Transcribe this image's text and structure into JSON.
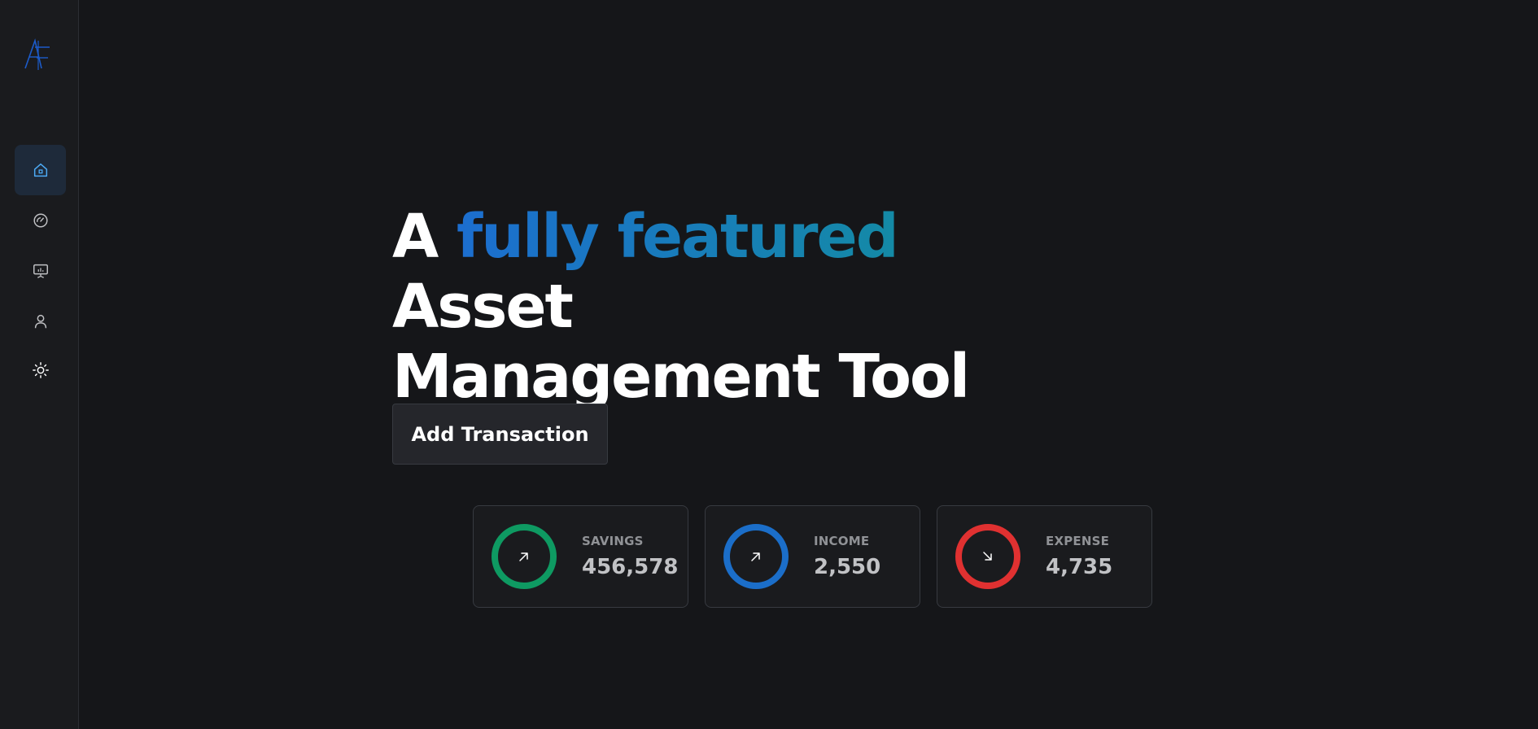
{
  "sidebar": {
    "logo": {
      "text": "AF",
      "color": "#1c5bc9"
    },
    "items": [
      {
        "icon": "home-icon",
        "active": true
      },
      {
        "icon": "gauge-icon",
        "active": false
      },
      {
        "icon": "presentation-chart-icon",
        "active": false
      },
      {
        "icon": "user-icon",
        "active": false
      },
      {
        "icon": "sun-icon",
        "active": false
      }
    ]
  },
  "hero": {
    "prefix": "A ",
    "highlight": "fully featured",
    "suffix_line1": " Asset",
    "line2": "Management Tool"
  },
  "actions": {
    "add_transaction_label": "Add Transaction"
  },
  "stats": [
    {
      "label": "SAVINGS",
      "value": "456,578",
      "color": "#0e9a62",
      "arrow": "arrow-up-right-icon"
    },
    {
      "label": "INCOME",
      "value": "2,550",
      "color": "#1b6ec9",
      "arrow": "arrow-up-right-icon"
    },
    {
      "label": "EXPENSE",
      "value": "4,735",
      "color": "#e03131",
      "arrow": "arrow-down-right-icon"
    }
  ],
  "colors": {
    "background": "#151619",
    "sidebar": "#1a1b1e",
    "accent_blue": "#1c6ed0",
    "accent_teal": "#148aa6"
  }
}
